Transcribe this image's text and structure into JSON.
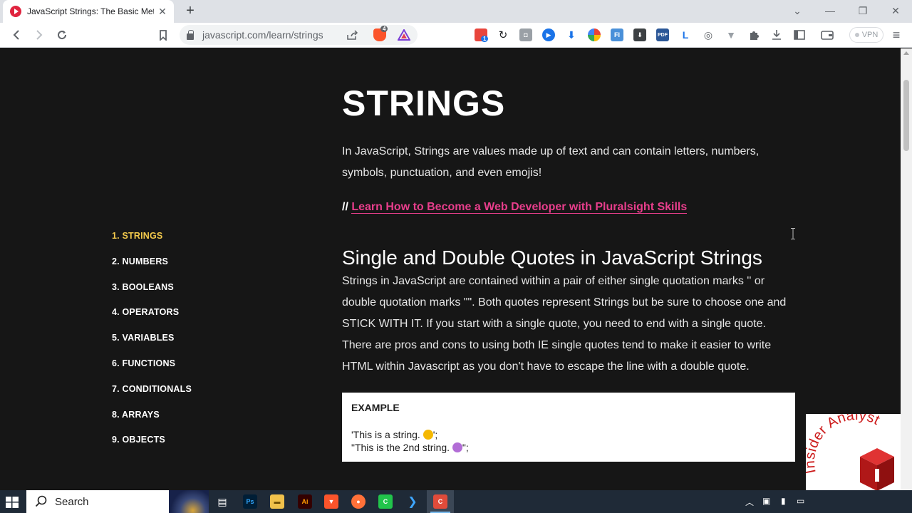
{
  "browser": {
    "tab_title": "JavaScript Strings: The Basic Meth",
    "url": "javascript.com/learn/strings",
    "brave_badge": "4",
    "ext_badge": "1",
    "vpn_label": "VPN"
  },
  "sidebar": {
    "items": [
      {
        "label": "1. STRINGS",
        "active": true
      },
      {
        "label": "2. NUMBERS"
      },
      {
        "label": "3. BOOLEANS"
      },
      {
        "label": "4. OPERATORS"
      },
      {
        "label": "5. VARIABLES"
      },
      {
        "label": "6. FUNCTIONS"
      },
      {
        "label": "7. CONDITIONALS"
      },
      {
        "label": "8. ARRAYS"
      },
      {
        "label": "9. OBJECTS"
      }
    ]
  },
  "content": {
    "title": "STRINGS",
    "intro": "In JavaScript, Strings are values made up of text and can contain letters, numbers, symbols, punctuation, and even emojis!",
    "promo_prefix": "// ",
    "promo_link": "Learn How to Become a Web Developer with Pluralsight Skills",
    "section_heading": "Single and Double Quotes in JavaScript Strings",
    "section_body": "Strings in JavaScript are contained within a pair of either single quotation marks '' or double quotation marks \"\". Both quotes represent Strings but be sure to choose one and STICK WITH IT. If you start with a single quote, you need to end with a single quote. There are pros and cons to using both IE single quotes tend to make it easier to write HTML within Javascript as you don't have to escape the line with a double quote.",
    "example_label": "EXAMPLE",
    "example_line1_a": "'This is a string. ",
    "example_line1_b": "';",
    "example_line2_a": "\"This is the 2nd string. ",
    "example_line2_b": "\";"
  },
  "watermark": {
    "text": "Insider Analyst",
    "colors": {
      "text": "#cc1b1b",
      "cube": "#c41e1e"
    }
  },
  "taskbar": {
    "search_placeholder": "Search"
  },
  "colors": {
    "page_bg": "#161616",
    "active_nav": "#f2c94c",
    "link": "#e83e8c"
  }
}
